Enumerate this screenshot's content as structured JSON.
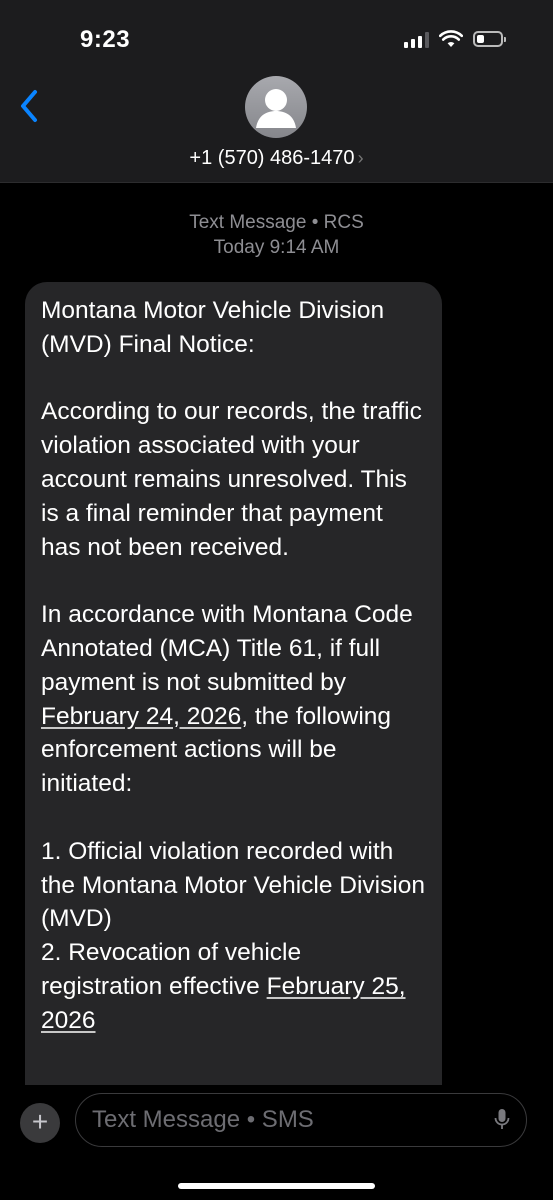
{
  "status_bar": {
    "time": "9:23"
  },
  "header": {
    "contact": "+1 (570) 486-1470",
    "chevron": "›"
  },
  "conversation": {
    "service_line": "Text Message • RCS",
    "timestamp": "Today 9:14 AM"
  },
  "message": {
    "p1": "Montana Motor Vehicle Division (MVD) Final Notice:",
    "p2": "According to our records, the traffic violation associated with your account remains unresolved. This is a final reminder that payment has not been received.",
    "p3_a": "In accordance with Montana Code Annotated (MCA) Title 61, if full payment is not submitted by ",
    "p3_link": "February 24, 2026",
    "p3_b": ", the following enforcement actions will be initiated:",
    "item1": "1. Official violation recorded with the Montana Motor Vehicle Division (MVD)",
    "item2_a": "2. Revocation of vehicle registration effective ",
    "item2_link": "February 25, 2026"
  },
  "composer": {
    "plus_label": "+",
    "placeholder": "Text Message • SMS"
  },
  "icons": [
    "back-chevron-icon",
    "contact-avatar-icon",
    "cellular-signal-icon",
    "wifi-icon",
    "battery-icon",
    "microphone-icon",
    "plus-icon"
  ]
}
